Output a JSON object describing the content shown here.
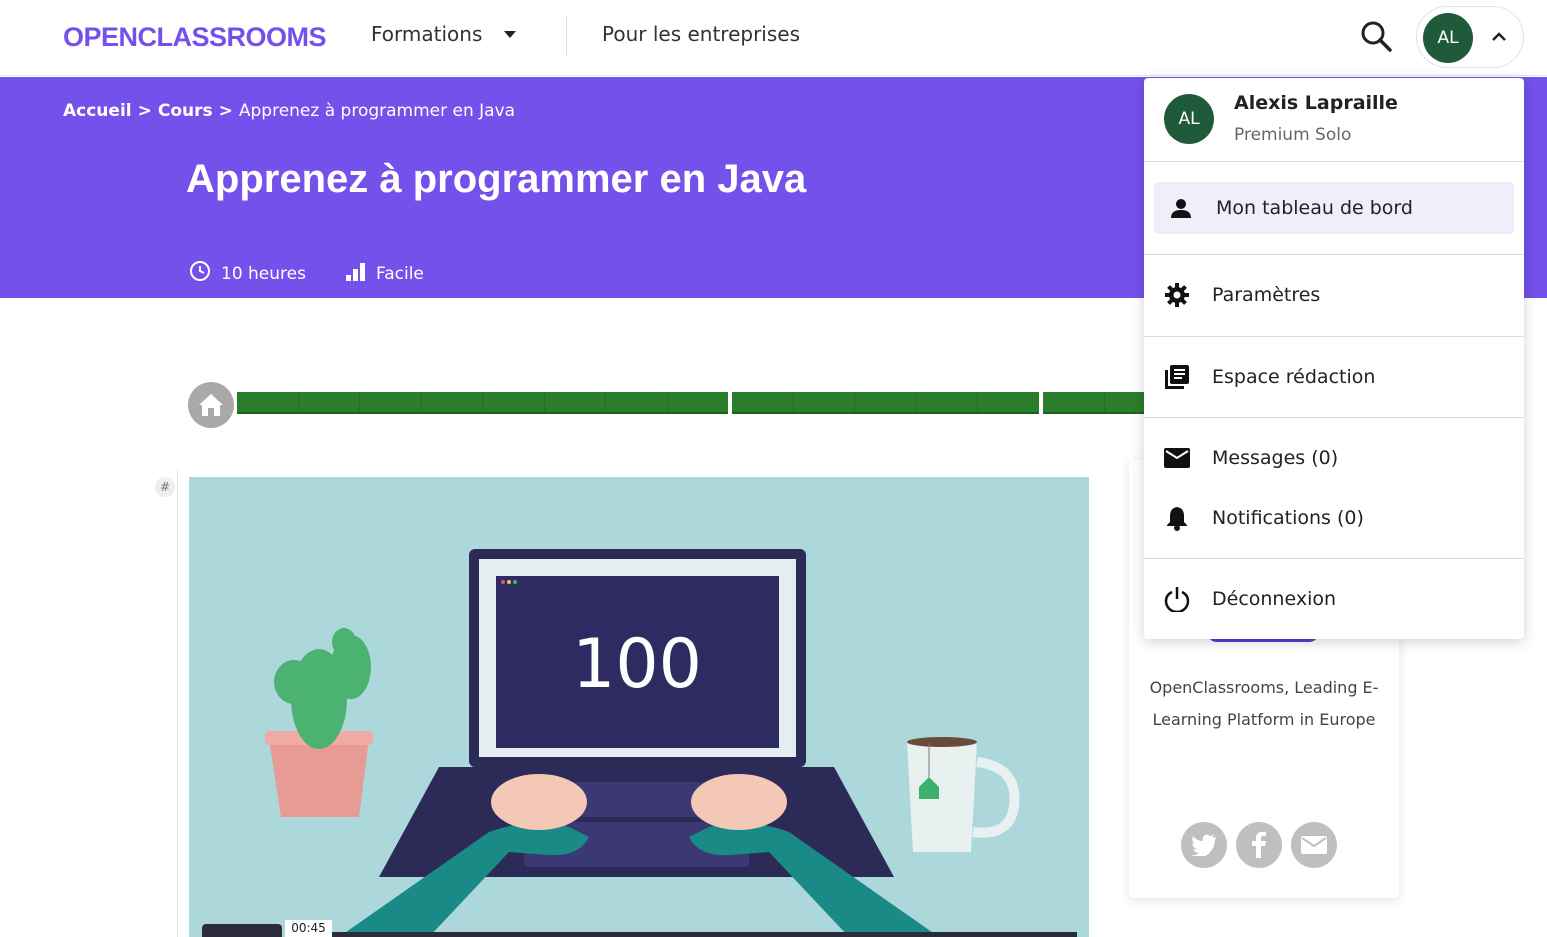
{
  "header": {
    "logo": "OPENCLASSROOMS",
    "nav_formations": "Formations",
    "nav_entreprises": "Pour les entreprises",
    "user_initials": "AL"
  },
  "hero": {
    "breadcrumb": {
      "home": "Accueil",
      "sep1": ">",
      "courses": "Cours",
      "sep2": ">",
      "current": "Apprenez à programmer en Java"
    },
    "title": "Apprenez à programmer en Java",
    "duration": "10 heures",
    "difficulty": "Facile"
  },
  "video": {
    "screen_number": "100",
    "time": "00:45"
  },
  "side_card": {
    "description": "OpenClassrooms, Leading E-Learning Platform in Europe",
    "share_icons": [
      "twitter-icon",
      "facebook-icon",
      "mail-icon"
    ]
  },
  "dropdown": {
    "avatar_initials": "AL",
    "user_name": "Alexis Lapraille",
    "plan": "Premium Solo",
    "items": [
      {
        "label": "Mon tableau de bord",
        "icon": "person-icon"
      },
      {
        "label": "Paramètres",
        "icon": "gear-icon"
      },
      {
        "label": "Espace rédaction",
        "icon": "library-icon"
      },
      {
        "label": "Messages (0)",
        "icon": "mail-icon"
      },
      {
        "label": "Notifications (0)",
        "icon": "bell-icon"
      },
      {
        "label": "Déconnexion",
        "icon": "power-icon"
      }
    ]
  },
  "colors": {
    "brand": "#7451eb",
    "avatar": "#1f5b3a",
    "progress": "#2a7d2a"
  }
}
